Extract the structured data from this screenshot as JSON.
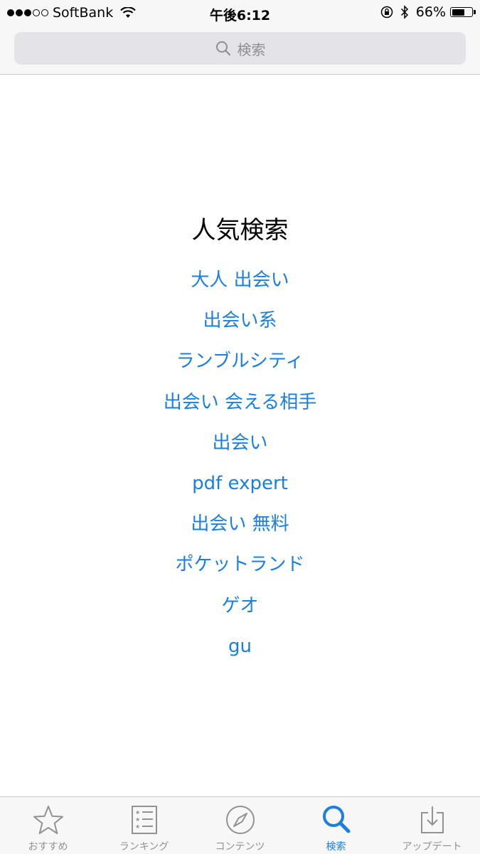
{
  "status_bar": {
    "carrier": "SoftBank",
    "time": "午後6:12",
    "battery_percent_text": "66%",
    "battery_level": 0.66,
    "signal_bars_filled": 3,
    "signal_bars_total": 5
  },
  "search": {
    "placeholder": "検索",
    "icon": "search-icon"
  },
  "trending": {
    "title": "人気検索",
    "items": [
      "大人 出会い",
      "出会い系",
      "ランブルシティ",
      "出会い 会える相手",
      "出会い",
      "pdf expert",
      "出会い 無料",
      "ポケットランド",
      "ゲオ",
      "gu"
    ]
  },
  "tab_bar": {
    "tabs": [
      {
        "label": "おすすめ",
        "icon": "star-icon"
      },
      {
        "label": "ランキング",
        "icon": "ranking-list-icon"
      },
      {
        "label": "コンテンツ",
        "icon": "compass-icon"
      },
      {
        "label": "検索",
        "icon": "search-icon",
        "active": true
      },
      {
        "label": "アップデート",
        "icon": "update-download-icon"
      }
    ]
  },
  "colors": {
    "accent": "#1a7fe0",
    "inactive": "#929292",
    "bar_background": "#f7f7f7"
  }
}
